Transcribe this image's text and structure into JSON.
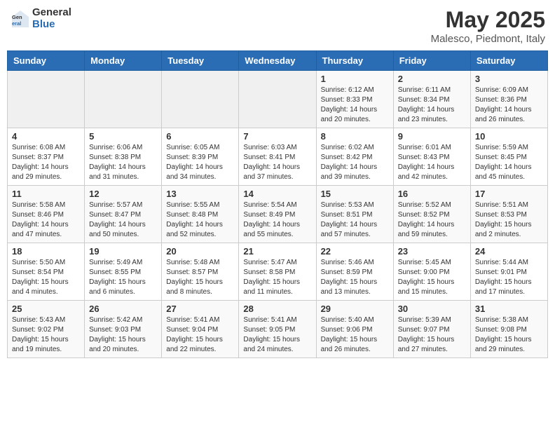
{
  "logo": {
    "general": "General",
    "blue": "Blue"
  },
  "title": "May 2025",
  "subtitle": "Malesco, Piedmont, Italy",
  "headers": [
    "Sunday",
    "Monday",
    "Tuesday",
    "Wednesday",
    "Thursday",
    "Friday",
    "Saturday"
  ],
  "weeks": [
    [
      {
        "day": "",
        "info": ""
      },
      {
        "day": "",
        "info": ""
      },
      {
        "day": "",
        "info": ""
      },
      {
        "day": "",
        "info": ""
      },
      {
        "day": "1",
        "info": "Sunrise: 6:12 AM\nSunset: 8:33 PM\nDaylight: 14 hours\nand 20 minutes."
      },
      {
        "day": "2",
        "info": "Sunrise: 6:11 AM\nSunset: 8:34 PM\nDaylight: 14 hours\nand 23 minutes."
      },
      {
        "day": "3",
        "info": "Sunrise: 6:09 AM\nSunset: 8:36 PM\nDaylight: 14 hours\nand 26 minutes."
      }
    ],
    [
      {
        "day": "4",
        "info": "Sunrise: 6:08 AM\nSunset: 8:37 PM\nDaylight: 14 hours\nand 29 minutes."
      },
      {
        "day": "5",
        "info": "Sunrise: 6:06 AM\nSunset: 8:38 PM\nDaylight: 14 hours\nand 31 minutes."
      },
      {
        "day": "6",
        "info": "Sunrise: 6:05 AM\nSunset: 8:39 PM\nDaylight: 14 hours\nand 34 minutes."
      },
      {
        "day": "7",
        "info": "Sunrise: 6:03 AM\nSunset: 8:41 PM\nDaylight: 14 hours\nand 37 minutes."
      },
      {
        "day": "8",
        "info": "Sunrise: 6:02 AM\nSunset: 8:42 PM\nDaylight: 14 hours\nand 39 minutes."
      },
      {
        "day": "9",
        "info": "Sunrise: 6:01 AM\nSunset: 8:43 PM\nDaylight: 14 hours\nand 42 minutes."
      },
      {
        "day": "10",
        "info": "Sunrise: 5:59 AM\nSunset: 8:45 PM\nDaylight: 14 hours\nand 45 minutes."
      }
    ],
    [
      {
        "day": "11",
        "info": "Sunrise: 5:58 AM\nSunset: 8:46 PM\nDaylight: 14 hours\nand 47 minutes."
      },
      {
        "day": "12",
        "info": "Sunrise: 5:57 AM\nSunset: 8:47 PM\nDaylight: 14 hours\nand 50 minutes."
      },
      {
        "day": "13",
        "info": "Sunrise: 5:55 AM\nSunset: 8:48 PM\nDaylight: 14 hours\nand 52 minutes."
      },
      {
        "day": "14",
        "info": "Sunrise: 5:54 AM\nSunset: 8:49 PM\nDaylight: 14 hours\nand 55 minutes."
      },
      {
        "day": "15",
        "info": "Sunrise: 5:53 AM\nSunset: 8:51 PM\nDaylight: 14 hours\nand 57 minutes."
      },
      {
        "day": "16",
        "info": "Sunrise: 5:52 AM\nSunset: 8:52 PM\nDaylight: 14 hours\nand 59 minutes."
      },
      {
        "day": "17",
        "info": "Sunrise: 5:51 AM\nSunset: 8:53 PM\nDaylight: 15 hours\nand 2 minutes."
      }
    ],
    [
      {
        "day": "18",
        "info": "Sunrise: 5:50 AM\nSunset: 8:54 PM\nDaylight: 15 hours\nand 4 minutes."
      },
      {
        "day": "19",
        "info": "Sunrise: 5:49 AM\nSunset: 8:55 PM\nDaylight: 15 hours\nand 6 minutes."
      },
      {
        "day": "20",
        "info": "Sunrise: 5:48 AM\nSunset: 8:57 PM\nDaylight: 15 hours\nand 8 minutes."
      },
      {
        "day": "21",
        "info": "Sunrise: 5:47 AM\nSunset: 8:58 PM\nDaylight: 15 hours\nand 11 minutes."
      },
      {
        "day": "22",
        "info": "Sunrise: 5:46 AM\nSunset: 8:59 PM\nDaylight: 15 hours\nand 13 minutes."
      },
      {
        "day": "23",
        "info": "Sunrise: 5:45 AM\nSunset: 9:00 PM\nDaylight: 15 hours\nand 15 minutes."
      },
      {
        "day": "24",
        "info": "Sunrise: 5:44 AM\nSunset: 9:01 PM\nDaylight: 15 hours\nand 17 minutes."
      }
    ],
    [
      {
        "day": "25",
        "info": "Sunrise: 5:43 AM\nSunset: 9:02 PM\nDaylight: 15 hours\nand 19 minutes."
      },
      {
        "day": "26",
        "info": "Sunrise: 5:42 AM\nSunset: 9:03 PM\nDaylight: 15 hours\nand 20 minutes."
      },
      {
        "day": "27",
        "info": "Sunrise: 5:41 AM\nSunset: 9:04 PM\nDaylight: 15 hours\nand 22 minutes."
      },
      {
        "day": "28",
        "info": "Sunrise: 5:41 AM\nSunset: 9:05 PM\nDaylight: 15 hours\nand 24 minutes."
      },
      {
        "day": "29",
        "info": "Sunrise: 5:40 AM\nSunset: 9:06 PM\nDaylight: 15 hours\nand 26 minutes."
      },
      {
        "day": "30",
        "info": "Sunrise: 5:39 AM\nSunset: 9:07 PM\nDaylight: 15 hours\nand 27 minutes."
      },
      {
        "day": "31",
        "info": "Sunrise: 5:38 AM\nSunset: 9:08 PM\nDaylight: 15 hours\nand 29 minutes."
      }
    ]
  ]
}
